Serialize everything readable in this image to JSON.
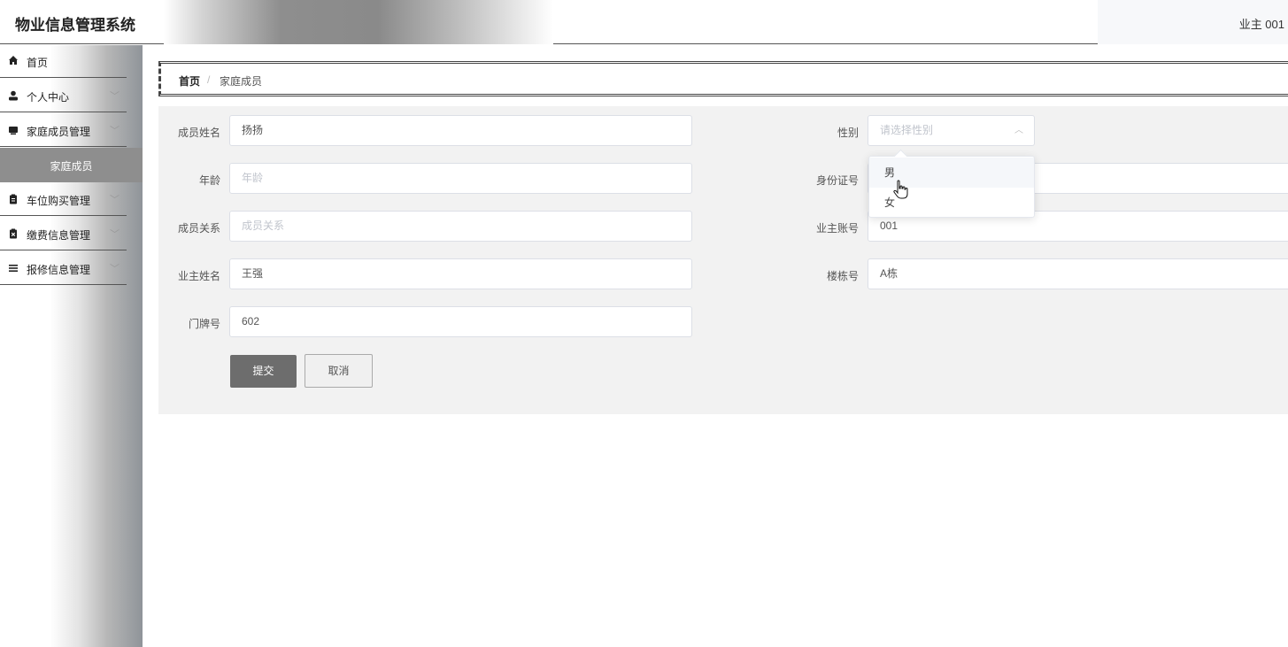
{
  "header": {
    "title": "物业信息管理系统",
    "user": "业主 001"
  },
  "sidebar": {
    "items": [
      {
        "label": "首页",
        "icon": "home-icon",
        "has_chevron": false
      },
      {
        "label": "个人中心",
        "icon": "user-icon",
        "has_chevron": true
      },
      {
        "label": "家庭成员管理",
        "icon": "card-icon",
        "has_chevron": true
      },
      {
        "label": "车位购买管理",
        "icon": "clipboard-icon",
        "has_chevron": true
      },
      {
        "label": "缴费信息管理",
        "icon": "clipboard-x-icon",
        "has_chevron": true
      },
      {
        "label": "报修信息管理",
        "icon": "list-icon",
        "has_chevron": true
      }
    ],
    "active_sub": "家庭成员",
    "chevron": "﹀"
  },
  "breadcrumb": {
    "home": "首页",
    "sep": "/",
    "current": "家庭成员"
  },
  "form": {
    "name": {
      "label": "成员姓名",
      "value": "扬扬"
    },
    "gender": {
      "label": "性别",
      "placeholder": "请选择性别"
    },
    "age": {
      "label": "年龄",
      "placeholder": "年龄"
    },
    "id_card": {
      "label": "身份证号"
    },
    "relation": {
      "label": "成员关系",
      "placeholder": "成员关系"
    },
    "owner_account": {
      "label": "业主账号",
      "value": "001"
    },
    "owner_name": {
      "label": "业主姓名",
      "value": "王强"
    },
    "building": {
      "label": "楼栋号",
      "value": "A栋"
    },
    "door": {
      "label": "门牌号",
      "value": "602"
    },
    "submit": "提交",
    "cancel": "取消"
  },
  "gender_options": [
    "男",
    "女"
  ],
  "colors": {
    "accent_gray": "#8e8e8e",
    "submit_bg": "#6d6d6d",
    "panel_bg": "#f2f2f2"
  }
}
